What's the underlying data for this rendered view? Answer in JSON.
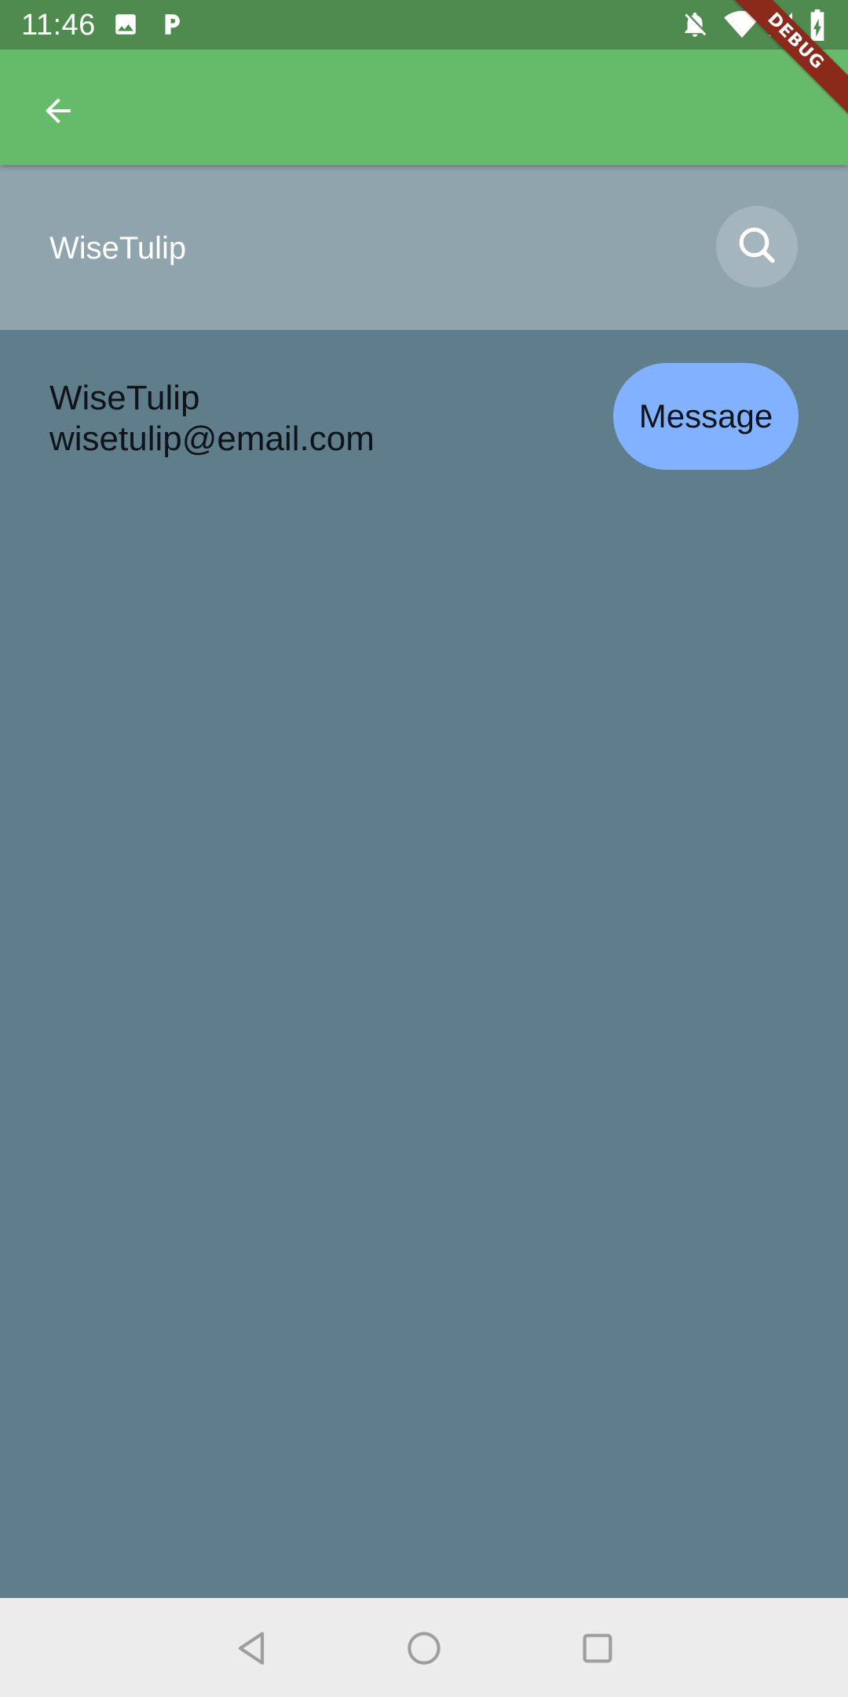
{
  "status_bar": {
    "time": "11:46",
    "left_icons": [
      "image-icon",
      "parking-icon"
    ],
    "right_icons": [
      "notifications-off-icon",
      "wifi-icon",
      "signal-icon",
      "battery-charging-icon"
    ]
  },
  "debug_banner": {
    "label": "DEBUG"
  },
  "app_bar": {
    "back_icon": "arrow-back-icon"
  },
  "search_header": {
    "query": "WiseTulip",
    "search_icon": "search-icon"
  },
  "result": {
    "name": "WiseTulip",
    "email": "wisetulip@email.com",
    "message_label": "Message"
  },
  "nav_bar": {
    "icons": [
      "back-triangle-icon",
      "home-circle-icon",
      "recents-square-icon"
    ]
  },
  "colors": {
    "status_bar": "#4f8b4f",
    "app_bar": "#66bb6a",
    "search_header": "#90a4ae",
    "body": "#607d8b",
    "message_button": "#82b1ff",
    "nav_bar": "#ececec",
    "debug_ribbon": "#8b2a1a"
  }
}
